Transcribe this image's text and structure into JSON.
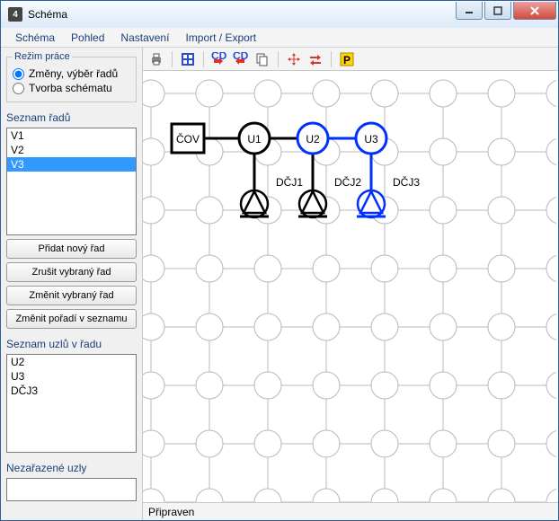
{
  "window": {
    "title": "Schéma",
    "app_badge": "4"
  },
  "menubar": [
    "Schéma",
    "Pohled",
    "Nastavení",
    "Import / Export"
  ],
  "mode": {
    "legend": "Režim práce",
    "opt_changes": "Změny, výběr řadů",
    "opt_create": "Tvorba schématu"
  },
  "rows": {
    "label": "Seznam řadů",
    "items": [
      "V1",
      "V2",
      "V3"
    ],
    "selected": "V3"
  },
  "buttons": {
    "add_row": "Přidat nový řad",
    "delete_row": "Zrušit vybraný řad",
    "edit_row": "Změnit vybraný řad",
    "reorder": "Změnit pořadí v seznamu"
  },
  "nodes": {
    "label": "Seznam uzlů v řadu",
    "items": [
      "U2",
      "U3",
      "DČJ3"
    ]
  },
  "unassigned": {
    "label": "Nezařazené uzly"
  },
  "status": "Připraven",
  "toolbar_icons": [
    "print-icon",
    "layout-icon",
    "cdf-in-icon",
    "cdf-out-icon",
    "copy-icon",
    "move-icon",
    "swap-icon",
    "parking-icon"
  ],
  "diagram": {
    "cov": "ČOV",
    "u1": "U1",
    "u2": "U2",
    "u3": "U3",
    "d1": "DČJ1",
    "d2": "DČJ2",
    "d3": "DČJ3"
  },
  "colors": {
    "accent": "#1a3e7b",
    "selection": "#3399ff",
    "diagram_selected": "#0030ff"
  }
}
